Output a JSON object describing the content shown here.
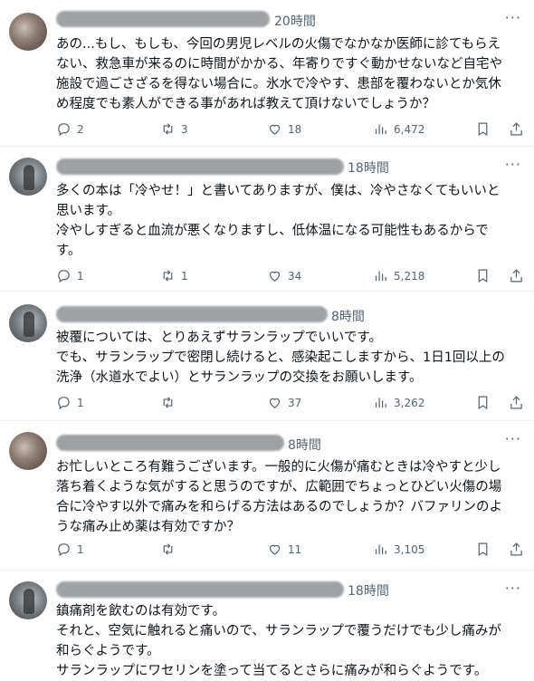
{
  "posts": [
    {
      "time": "20時間",
      "lines": [
        "あの...もし、もしも、今回の男児レベルの火傷でなかなか医師に診てもらえ",
        "ない、救急車が来るのに時間がかかる、年寄りですぐ動かせないなど自宅や",
        "施設で過ごさざるを得ない場合に。氷水で冷やす、患部を覆わないとか気休",
        "め程度でも素人ができる事があれば教えて頂けないでしょうか？"
      ],
      "replies": "2",
      "reposts": "3",
      "likes": "18",
      "views": "6,472"
    },
    {
      "time": "18時間",
      "lines": [
        "多くの本は「冷やせ！」と書いてありますが、僕は、冷やさなくてもいいと",
        "思います。",
        "冷やしすぎると血流が悪くなりますし、低体温になる可能性もあるからで",
        "す。"
      ],
      "replies": "1",
      "reposts": "1",
      "likes": "34",
      "views": "5,218"
    },
    {
      "time": "8時間",
      "lines": [
        "被覆については、とりあえずサランラップでいいです。",
        "でも、サランラップで密閉し続けると、感染起こしますから、1日1回以上の",
        "洗浄（水道水でよい）とサランラップの交換をお願いします。"
      ],
      "replies": "1",
      "reposts": "",
      "likes": "37",
      "views": "3,262"
    },
    {
      "time": "8時間",
      "lines": [
        "お忙しいところ有難うございます。一般的に火傷が痛むときは冷やすと少し",
        "落ち着くような気がすると思うのですが、広範囲でちょっとひどい火傷の場",
        "合に冷やす以外で痛みを和らげる方法はあるのでしょうか？バファリンのよ",
        "うな痛み止め薬は有効ですか？"
      ],
      "replies": "1",
      "reposts": "",
      "likes": "11",
      "views": "3,105"
    },
    {
      "time": "18時間",
      "lines": [
        "鎮痛剤を飲むのは有効です。",
        "それと、空気に触れると痛いので、サランラップで覆うだけでも少し痛みが",
        "和らぐようです。",
        "サランラップにワセリンを塗って当てるとさらに痛みが和らぐようです。"
      ]
    }
  ],
  "icons": {
    "reply": "reply-icon",
    "repost": "repost-icon",
    "like": "heart-icon",
    "views": "views-icon",
    "bookmark": "bookmark-icon",
    "share": "share-icon",
    "more": "more-icon"
  },
  "more_glyph": "···"
}
